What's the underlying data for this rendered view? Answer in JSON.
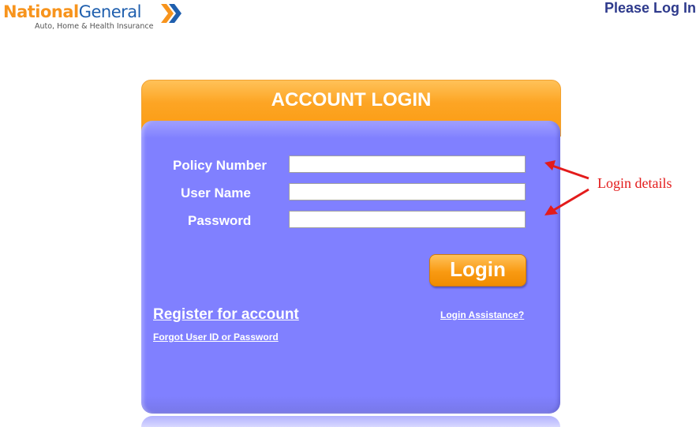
{
  "brand": {
    "name_part1": "National",
    "name_part2": "General",
    "tagline": "Auto, Home & Health Insurance",
    "colors": {
      "orange": "#f7941d",
      "blue": "#1f5fae"
    }
  },
  "header": {
    "status_text": "Please Log In"
  },
  "login_panel": {
    "title": "ACCOUNT LOGIN",
    "fields": [
      {
        "label": "Policy Number",
        "value": "",
        "placeholder": ""
      },
      {
        "label": "User Name",
        "value": "",
        "placeholder": ""
      },
      {
        "label": "Password",
        "value": "",
        "placeholder": ""
      }
    ],
    "login_button": "Login",
    "register_link": "Register for account",
    "forgot_link": "Forgot User ID or Password",
    "assistance_link": "Login Assistance?",
    "colors": {
      "header": "#fb9a10",
      "body": "#8080ff"
    }
  },
  "annotation": {
    "text": "Login details",
    "color": "#e31b1b"
  }
}
